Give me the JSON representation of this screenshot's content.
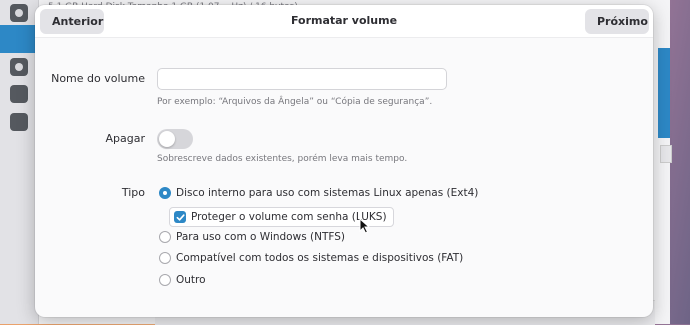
{
  "background": {
    "header_text": "5,1 GB Hard Disk        Tamanho    1 GB (1.07… Hz) / 16 bytes)"
  },
  "dialog": {
    "title": "Formatar volume",
    "back_label": "Anterior",
    "next_label": "Próximo"
  },
  "form": {
    "volume_name": {
      "label": "Nome do volume",
      "value": "",
      "hint": "Por exemplo: “Arquivos da Ângela” ou “Cópia de segurança”."
    },
    "erase": {
      "label": "Apagar",
      "enabled": false,
      "hint": "Sobrescreve dados existentes, porém leva mais tempo."
    },
    "type": {
      "label": "Tipo",
      "options": [
        {
          "label": "Disco interno para uso com sistemas Linux apenas (Ext4)",
          "selected": true
        },
        {
          "label": "Para uso com o Windows (NTFS)",
          "selected": false
        },
        {
          "label": "Compatível com todos os sistemas e dispositivos (FAT)",
          "selected": false
        },
        {
          "label": "Outro",
          "selected": false
        }
      ],
      "password_protect": {
        "label": "Proteger o volume com senha (LUKS)",
        "checked": true
      }
    }
  },
  "colors": {
    "accent": "#2d88c6",
    "dialog_bg": "#fafafb",
    "text": "#2e2e33"
  }
}
